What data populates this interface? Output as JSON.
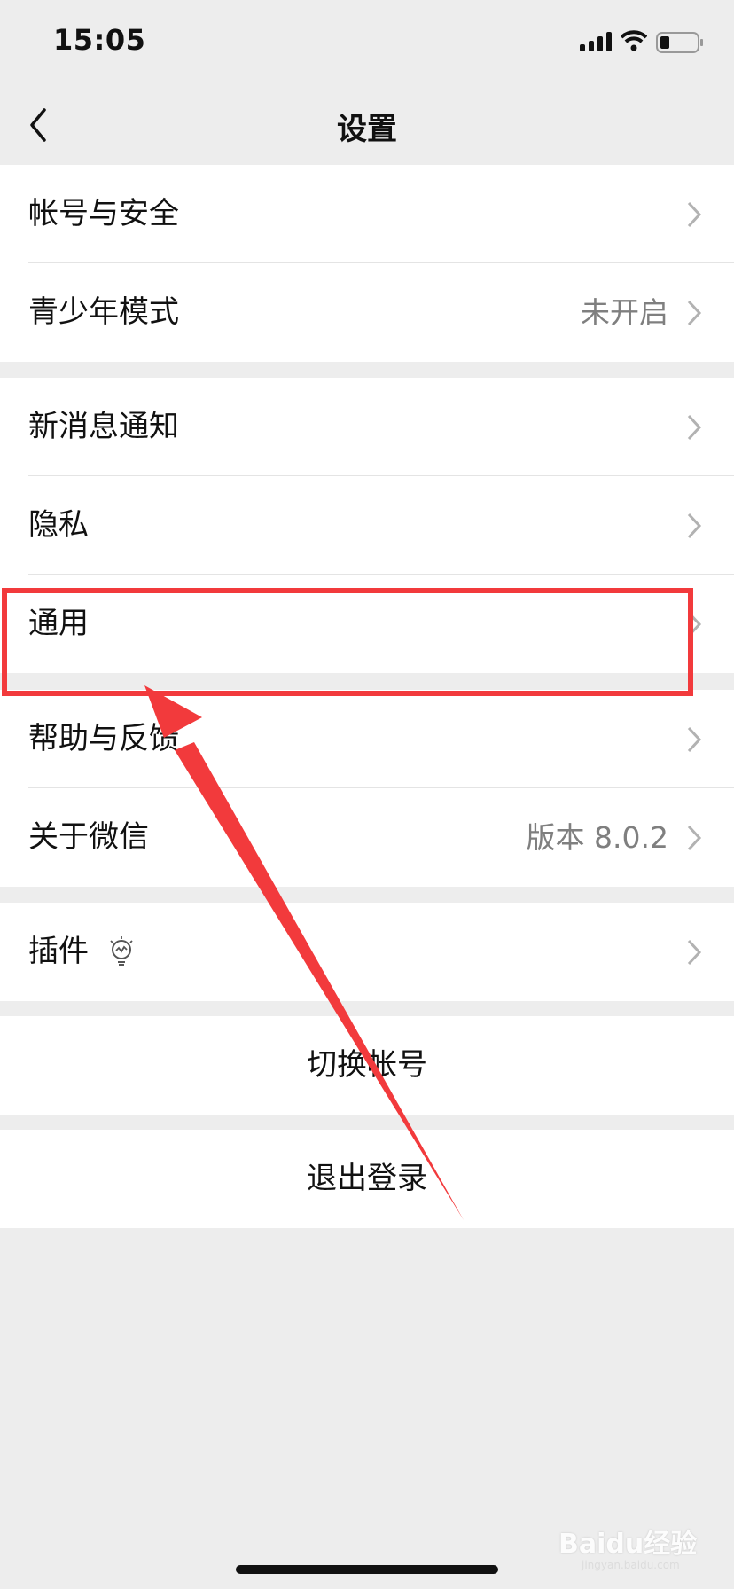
{
  "status_bar": {
    "time": "15:05"
  },
  "nav": {
    "title": "设置"
  },
  "groups": [
    {
      "items": [
        {
          "label": "帐号与安全",
          "value": ""
        },
        {
          "label": "青少年模式",
          "value": "未开启"
        }
      ]
    },
    {
      "items": [
        {
          "label": "新消息通知",
          "value": ""
        },
        {
          "label": "隐私",
          "value": ""
        },
        {
          "label": "通用",
          "value": ""
        }
      ]
    },
    {
      "items": [
        {
          "label": "帮助与反馈",
          "value": ""
        },
        {
          "label": "关于微信",
          "value": "版本 8.0.2"
        }
      ]
    },
    {
      "items": [
        {
          "label": "插件",
          "value": ""
        }
      ]
    }
  ],
  "actions": {
    "switch_account": "切换帐号",
    "logout": "退出登录"
  },
  "watermark": {
    "brand": "Baidu经验",
    "url": "jingyan.baidu.com"
  },
  "colors": {
    "highlight": "#f23a3c",
    "background": "#ededed"
  }
}
